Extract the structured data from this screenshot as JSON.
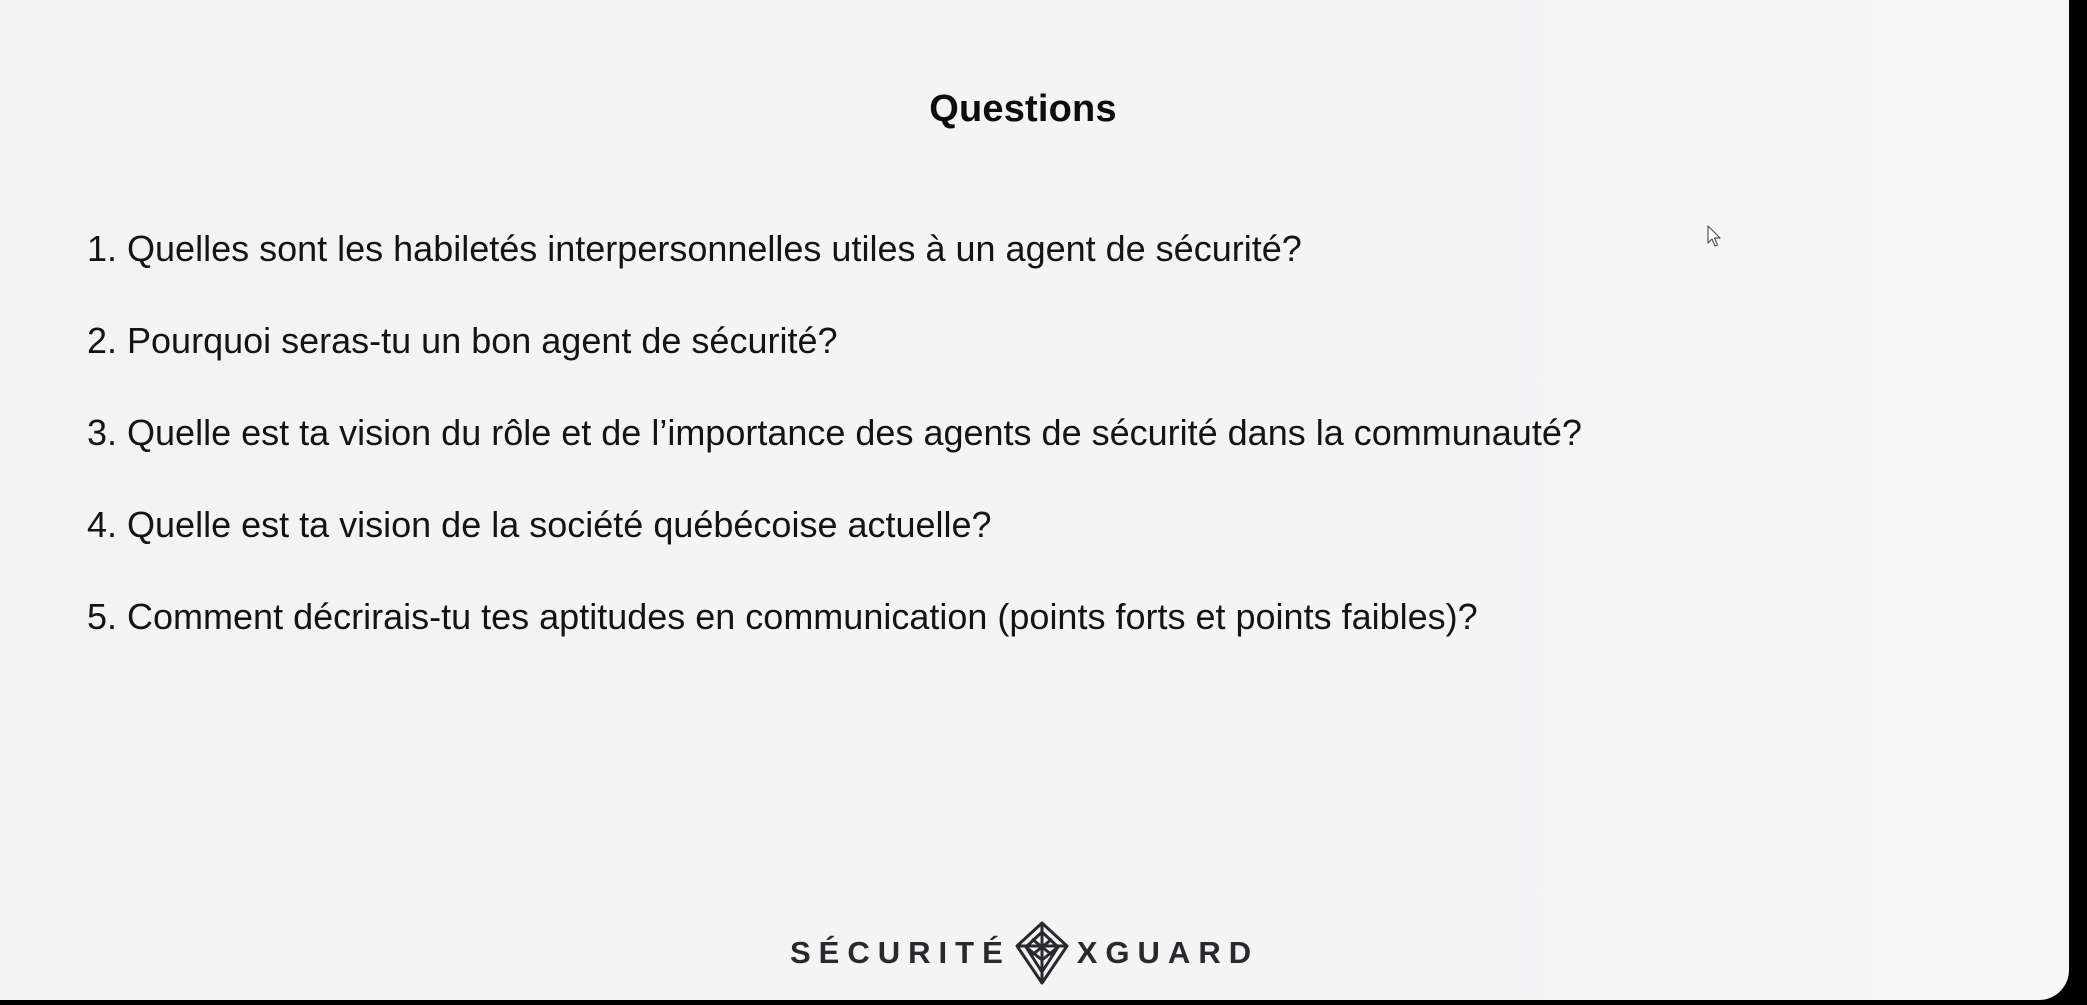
{
  "slide": {
    "title": "Questions",
    "questions": [
      "1. Quelles sont les habiletés interpersonnelles utiles à un agent de sécurité?",
      "2. Pourquoi seras-tu un bon agent de sécurité?",
      "3. Quelle est ta vision du rôle et de l’importance des agents de sécurité dans la communauté?",
      "4. Quelle est ta vision de la société québécoise actuelle?",
      "5. Comment décrirais-tu tes aptitudes en communication (points forts et points faibles)?"
    ]
  },
  "brand": {
    "left_word": "SÉCURITÉ",
    "right_word": "XGUARD",
    "emblem_icon": "shield-emblem-icon"
  },
  "cursor": {
    "icon": "mouse-pointer-icon"
  },
  "colors": {
    "background": "#f4f4f5",
    "text": "#141414",
    "frame": "#000000",
    "brand": "#2a2a2e"
  }
}
